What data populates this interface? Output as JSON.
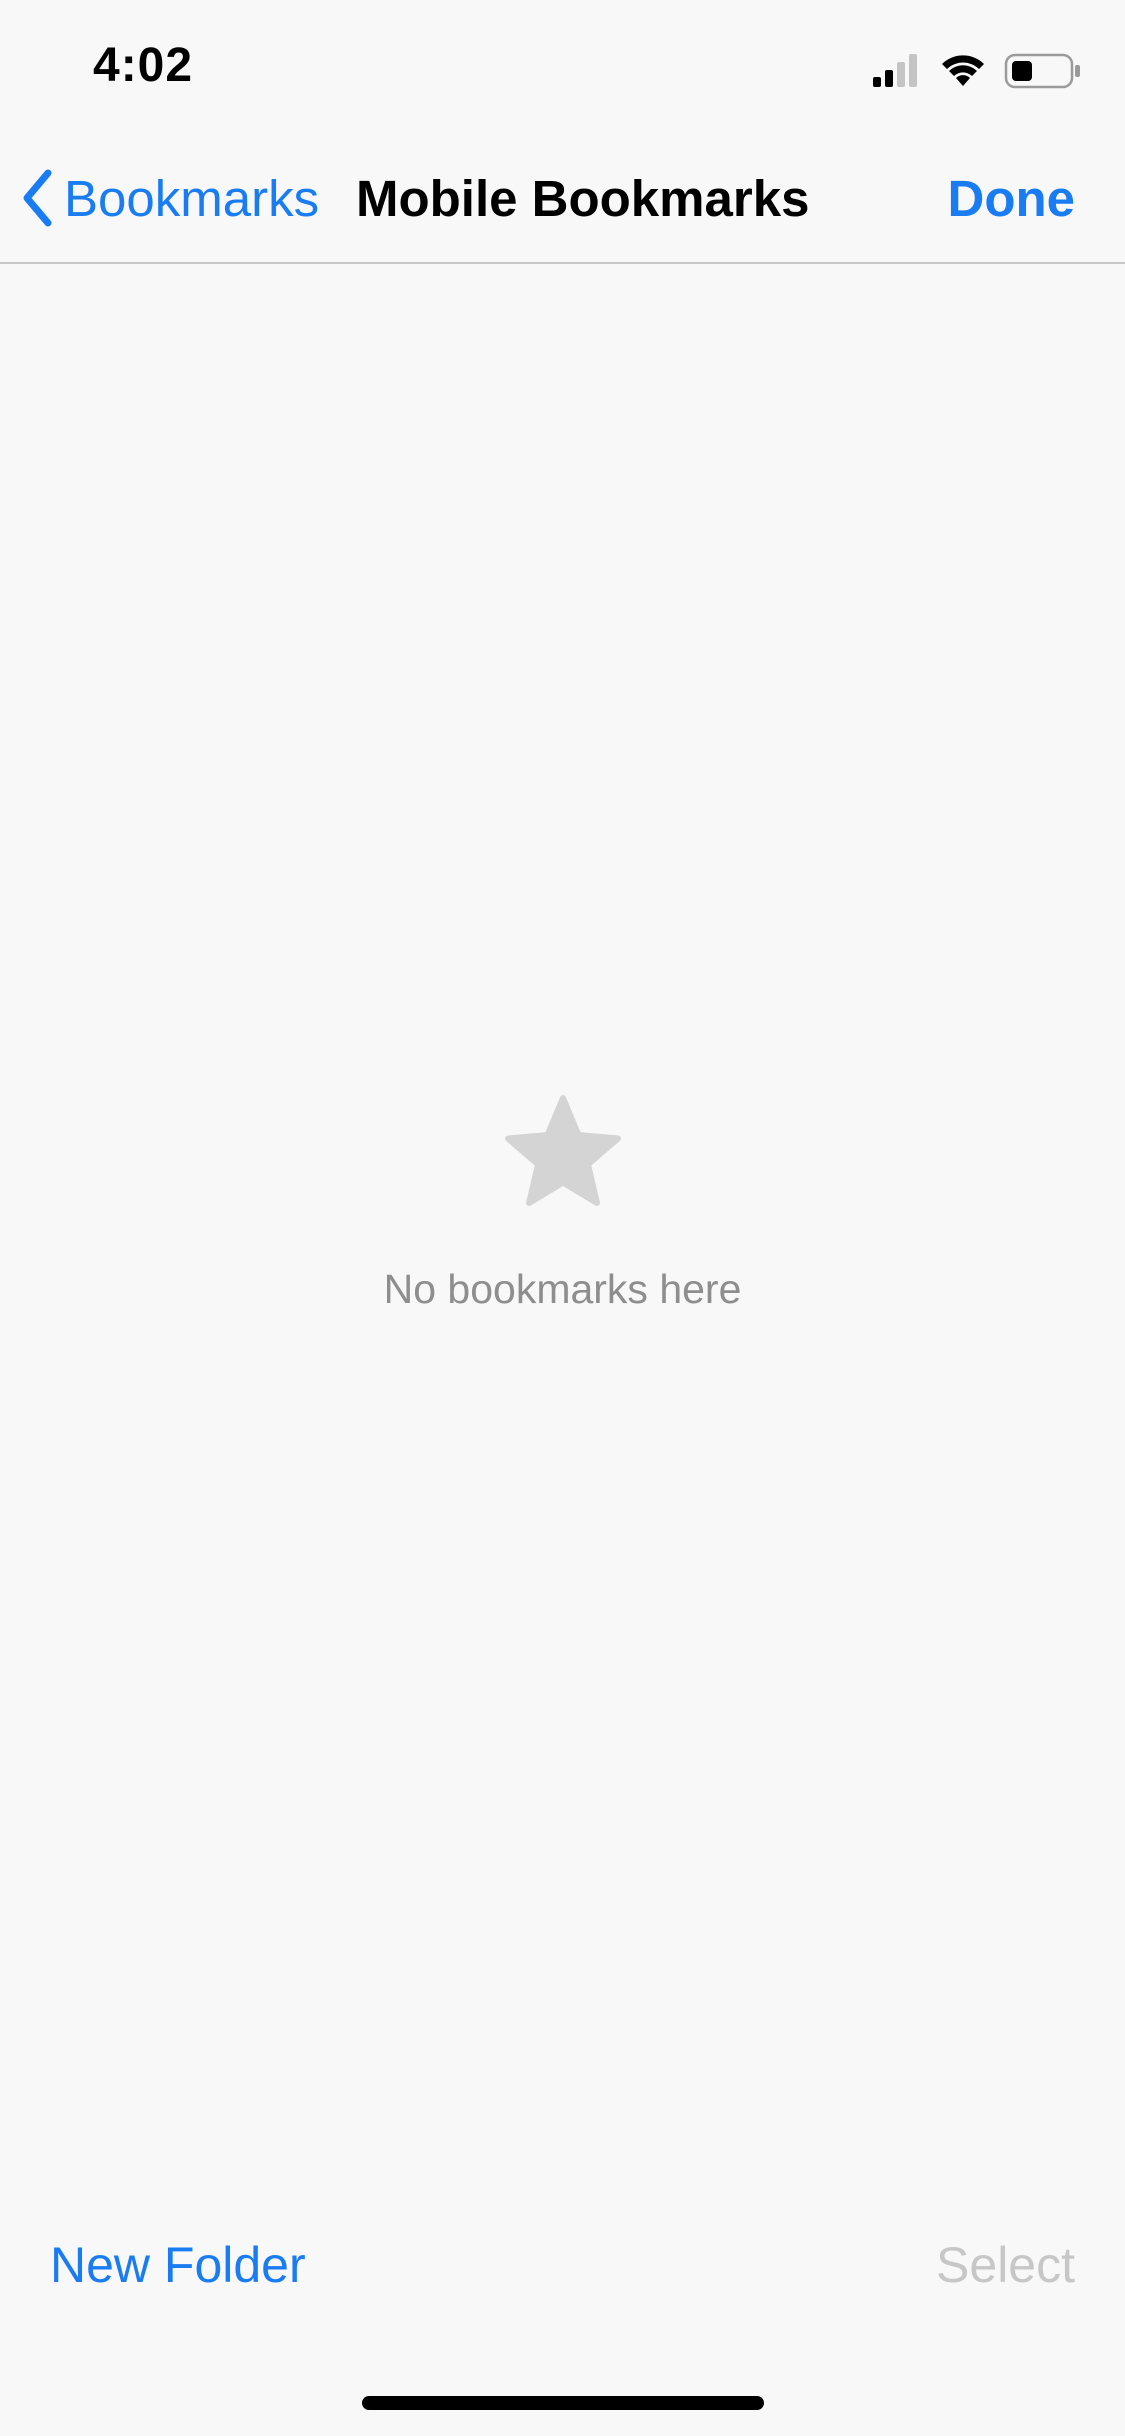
{
  "status_bar": {
    "time": "4:02",
    "icons": [
      "cellular-signal-icon",
      "wifi-icon",
      "battery-icon"
    ]
  },
  "nav_bar": {
    "back_label": "Bookmarks",
    "title": "Mobile Bookmarks",
    "done_label": "Done"
  },
  "empty_state": {
    "icon": "star-icon",
    "message": "No bookmarks here"
  },
  "toolbar": {
    "new_folder_label": "New Folder",
    "select_label": "Select",
    "select_enabled": false
  },
  "colors": {
    "accent": "#1a7cf2",
    "background": "#f8f8f8",
    "disabled": "#c7c7c7",
    "empty_text": "#8e8e8e",
    "star": "#d4d4d4"
  }
}
